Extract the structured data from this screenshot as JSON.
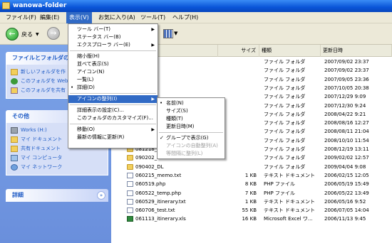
{
  "window": {
    "title": "wanowa-folder"
  },
  "menubar": [
    "ファイル(F)",
    "編集(E)",
    "表示(V)",
    "お気に入り(A)",
    "ツール(T)",
    "ヘルプ(H)"
  ],
  "toolbar": {
    "back_label": "戻る"
  },
  "columns": {
    "size": "サイズ",
    "type": "種類",
    "date": "更新日時"
  },
  "view_menu": [
    {
      "label": "ツール バー(T)",
      "arrow": true
    },
    {
      "label": "ステータス バー(B)"
    },
    {
      "label": "エクスプローラ バー(E)",
      "arrow": true
    },
    {
      "sep": true
    },
    {
      "label": "縮小版(H)"
    },
    {
      "label": "並べて表示(S)"
    },
    {
      "label": "アイコン(N)"
    },
    {
      "label": "一覧(L)"
    },
    {
      "label": "詳細(D)",
      "mark": "•"
    },
    {
      "sep": true
    },
    {
      "label": "アイコンの整列(I)",
      "arrow": true,
      "highlight": true
    },
    {
      "sep": true
    },
    {
      "label": "詳細表示の設定(C)..."
    },
    {
      "label": "このフォルダのカスタマイズ(F)..."
    },
    {
      "sep": true
    },
    {
      "label": "移動(O)",
      "arrow": true
    },
    {
      "label": "最新の情報に更新(R)"
    }
  ],
  "arrange_menu": [
    {
      "label": "名前(N)",
      "mark": "•"
    },
    {
      "label": "サイズ(S)"
    },
    {
      "label": "種類(T)"
    },
    {
      "label": "更新日時(M)"
    },
    {
      "sep": true
    },
    {
      "label": "グループで表示(G)",
      "mark": "✓"
    },
    {
      "label": "アイコンの自動整列(A)",
      "disabled": true
    },
    {
      "label": "等間隔に整列(L)",
      "disabled": true
    }
  ],
  "left_panels": [
    {
      "title": "ファイルとフォルダのタ",
      "items": [
        {
          "label": "新しいフォルダを作",
          "icon": "new-folder-icon"
        },
        {
          "label": "このフォルダを Web",
          "icon": "publish-web-icon"
        },
        {
          "label": "このフォルダを共有",
          "icon": "share-folder-icon"
        }
      ]
    },
    {
      "title": "その他",
      "items": [
        {
          "label": "Works (H:)",
          "icon": "drive-icon"
        },
        {
          "label": "マイ ドキュメント",
          "icon": "my-documents-icon"
        },
        {
          "label": "共有ドキュメント",
          "icon": "shared-documents-icon"
        },
        {
          "label": "マイ コンピュータ",
          "icon": "my-computer-icon"
        },
        {
          "label": "マイ ネットワーク",
          "icon": "my-network-icon"
        }
      ]
    },
    {
      "title": "詳細",
      "items": []
    }
  ],
  "files": [
    {
      "name": "",
      "size": "",
      "type": "ファイル フォルダ",
      "date": "2007/09/02 23:37",
      "icon": "folder"
    },
    {
      "name": "",
      "size": "",
      "type": "ファイル フォルダ",
      "date": "2007/09/02 23:37",
      "icon": "folder"
    },
    {
      "name": "",
      "size": "",
      "type": "ファイル フォルダ",
      "date": "2007/09/05 23:36",
      "icon": "folder"
    },
    {
      "name": "",
      "size": "",
      "type": "ファイル フォルダ",
      "date": "2007/10/05 20:38",
      "icon": "folder"
    },
    {
      "name": "",
      "size": "",
      "type": "ファイル フォルダ",
      "date": "2007/12/29 9:09",
      "icon": "folder"
    },
    {
      "name": "",
      "size": "",
      "type": "ファイル フォルダ",
      "date": "2007/12/30 9:24",
      "icon": "folder"
    },
    {
      "name": "",
      "size": "",
      "type": "ファイル フォルダ",
      "date": "2008/04/22 9:21",
      "icon": "folder"
    },
    {
      "name": "",
      "size": "",
      "type": "ファイル フォルダ",
      "date": "2008/08/16 12:27",
      "icon": "folder"
    },
    {
      "name": "",
      "size": "",
      "type": "ファイル フォルダ",
      "date": "2008/08/11 21:04",
      "icon": "folder"
    },
    {
      "name": "081010_DL",
      "size": "",
      "type": "ファイル フォルダ",
      "date": "2008/10/10 11:54",
      "icon": "folder"
    },
    {
      "name": "081218_DL",
      "size": "",
      "type": "ファイル フォルダ",
      "date": "2008/12/19 13:11",
      "icon": "folder"
    },
    {
      "name": "090202_DL",
      "size": "",
      "type": "ファイル フォルダ",
      "date": "2009/02/02 12:57",
      "icon": "folder"
    },
    {
      "name": "090402_DL",
      "size": "",
      "type": "ファイル フォルダ",
      "date": "2009/04/04 9:08",
      "icon": "folder"
    },
    {
      "name": "060215_memo.txt",
      "size": "1 KB",
      "type": "テキスト ドキュメント",
      "date": "2006/02/15 12:05",
      "icon": "doc"
    },
    {
      "name": "060519.php",
      "size": "8 KB",
      "type": "PHP ファイル",
      "date": "2006/05/19 15:49",
      "icon": "doc"
    },
    {
      "name": "060522_temp.php",
      "size": "7 KB",
      "type": "PHP ファイル",
      "date": "2006/05/22 13:49",
      "icon": "doc"
    },
    {
      "name": "060529_itinerary.txt",
      "size": "1 KB",
      "type": "テキスト ドキュメント",
      "date": "2006/05/16 9:52",
      "icon": "doc"
    },
    {
      "name": "060706_test.txt",
      "size": "55 KB",
      "type": "テキスト ドキュメント",
      "date": "2006/07/05 14:04",
      "icon": "doc"
    },
    {
      "name": "061113_itinerary.xls",
      "size": "16 KB",
      "type": "Microsoft Excel ワ...",
      "date": "2006/11/13 9:45",
      "icon": "xls"
    }
  ]
}
